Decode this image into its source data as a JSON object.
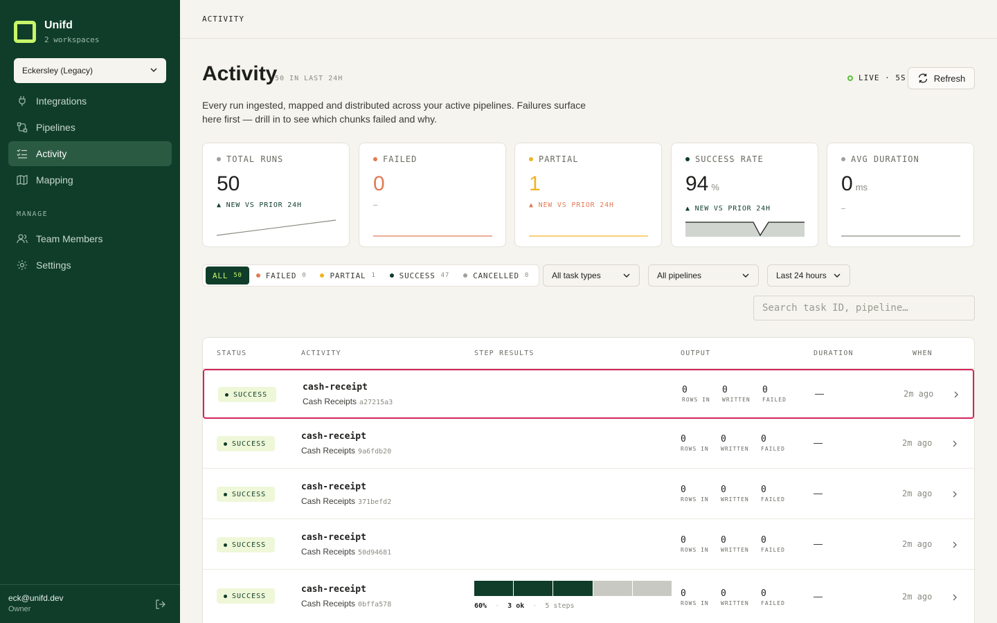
{
  "sidebar": {
    "brand": "Unifd",
    "workspaces": "2 workspaces",
    "workspace_select": "Eckersley (Legacy)",
    "nav": [
      {
        "label": "Integrations",
        "icon": "plug-icon"
      },
      {
        "label": "Pipelines",
        "icon": "pipeline-icon"
      },
      {
        "label": "Activity",
        "icon": "list-check-icon"
      },
      {
        "label": "Mapping",
        "icon": "map-icon"
      }
    ],
    "manage_label": "MANAGE",
    "manage": [
      {
        "label": "Team Members",
        "icon": "users-icon"
      },
      {
        "label": "Settings",
        "icon": "gear-icon"
      }
    ],
    "user_email": "eck@unifd.dev",
    "user_role": "Owner"
  },
  "topbar": {
    "crumb": "ACTIVITY"
  },
  "header": {
    "title": "Activity",
    "count": "50 IN LAST 24H",
    "live": "LIVE · 5S",
    "refresh": "Refresh",
    "description": "Every run ingested, mapped and distributed across your active pipelines. Failures surface here first — drill in to see which chunks failed and why."
  },
  "kpis": [
    {
      "label": "TOTAL RUNS",
      "value": "50",
      "unit": "",
      "delta": "▲ NEW VS PRIOR 24H",
      "color": "#1d1f1c",
      "dot": "#a0a09a"
    },
    {
      "label": "FAILED",
      "value": "0",
      "unit": "",
      "delta": "—",
      "color": "#e07b55",
      "dot": "#e07b55"
    },
    {
      "label": "PARTIAL",
      "value": "1",
      "unit": "",
      "delta": "▲ NEW VS PRIOR 24H",
      "color": "#f0b323",
      "dot": "#f0b323"
    },
    {
      "label": "SUCCESS RATE",
      "value": "94",
      "unit": "%",
      "delta": "▲ NEW VS PRIOR 24H",
      "color": "#1d1f1c",
      "dot": "#0f3d2a"
    },
    {
      "label": "AVG DURATION",
      "value": "0",
      "unit": "ms",
      "delta": "—",
      "color": "#1d1f1c",
      "dot": "#a0a09a"
    }
  ],
  "filters": {
    "segments": [
      {
        "label": "ALL",
        "count": "50",
        "dot": ""
      },
      {
        "label": "FAILED",
        "count": "0",
        "dot": "#e07b55"
      },
      {
        "label": "PARTIAL",
        "count": "1",
        "dot": "#f0b323"
      },
      {
        "label": "SUCCESS",
        "count": "47",
        "dot": "#0f3d2a"
      },
      {
        "label": "CANCELLED",
        "count": "0",
        "dot": "#a0a09a"
      }
    ],
    "task_types": "All task types",
    "pipelines": "All pipelines",
    "time_range": "Last 24 hours",
    "search_placeholder": "Search task ID, pipeline…"
  },
  "table": {
    "columns": [
      "STATUS",
      "ACTIVITY",
      "STEP RESULTS",
      "OUTPUT",
      "DURATION",
      "WHEN"
    ],
    "output_labels": [
      "ROWS IN",
      "WRITTEN",
      "FAILED"
    ],
    "rows": [
      {
        "status": "SUCCESS",
        "name": "cash-receipt",
        "pipeline": "Cash Receipts",
        "id": "a27215a3",
        "rows_in": "0",
        "written": "0",
        "failed": "0",
        "duration": "—",
        "when": "2m ago"
      },
      {
        "status": "SUCCESS",
        "name": "cash-receipt",
        "pipeline": "Cash Receipts",
        "id": "9a6fdb20",
        "rows_in": "0",
        "written": "0",
        "failed": "0",
        "duration": "—",
        "when": "2m ago"
      },
      {
        "status": "SUCCESS",
        "name": "cash-receipt",
        "pipeline": "Cash Receipts",
        "id": "371befd2",
        "rows_in": "0",
        "written": "0",
        "failed": "0",
        "duration": "—",
        "when": "2m ago"
      },
      {
        "status": "SUCCESS",
        "name": "cash-receipt",
        "pipeline": "Cash Receipts",
        "id": "50d94681",
        "rows_in": "0",
        "written": "0",
        "failed": "0",
        "duration": "—",
        "when": "2m ago"
      },
      {
        "status": "SUCCESS",
        "name": "cash-receipt",
        "pipeline": "Cash Receipts",
        "id": "0bffa578",
        "rows_in": "0",
        "written": "0",
        "failed": "0",
        "duration": "—",
        "when": "2m ago",
        "steps": {
          "percent": "60%",
          "ok": "3 ok",
          "total": "5 steps",
          "ok_count": 3,
          "step_count": 5
        }
      }
    ]
  },
  "colors": {
    "sidebar": "#0f3d2a",
    "accent": "#c8f56a",
    "selected_border": "#d3245a"
  }
}
